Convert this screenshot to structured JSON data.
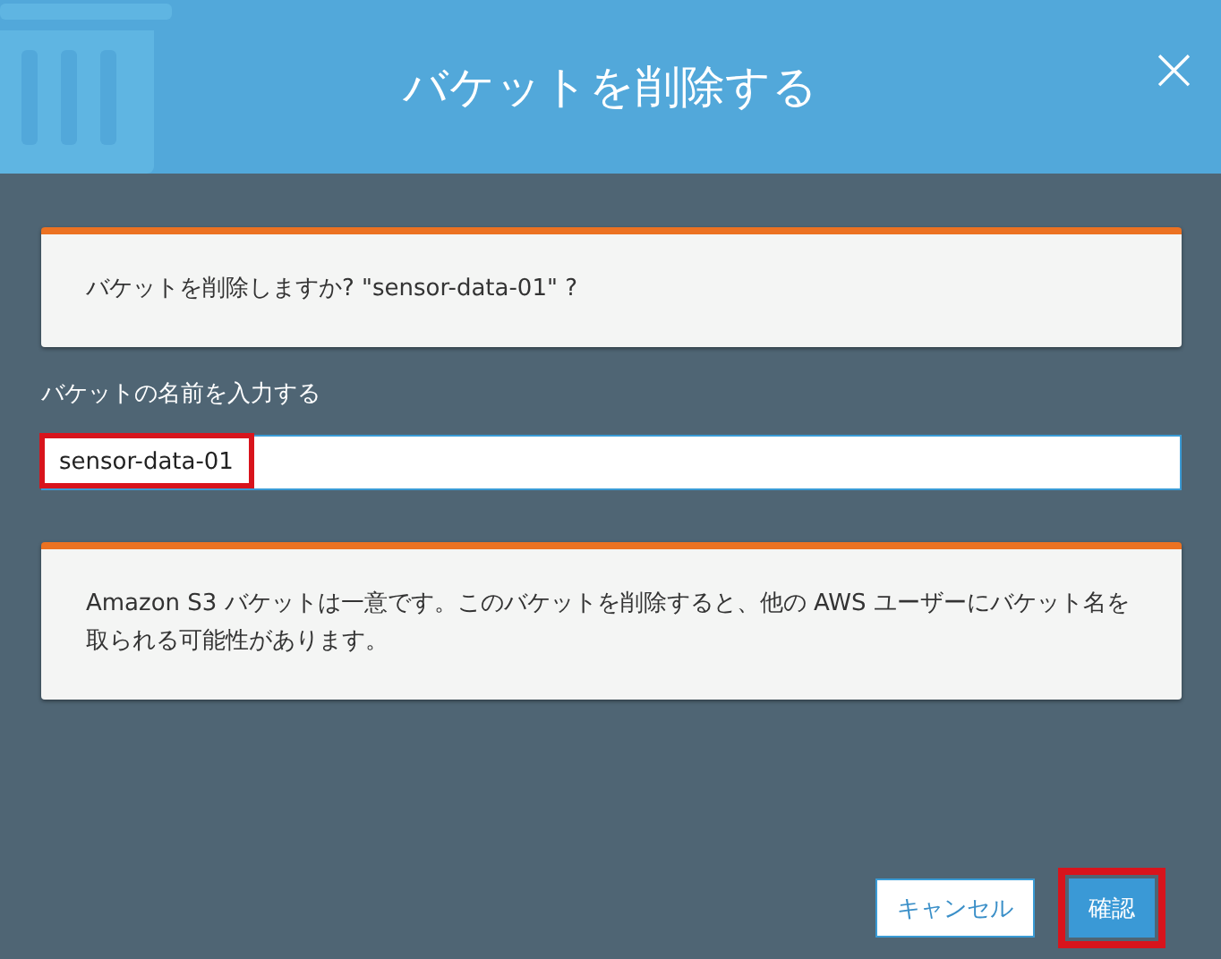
{
  "dialog": {
    "title": "バケットを削除する",
    "close": "×"
  },
  "confirm_message": "バケットを削除しますか? \"sensor-data-01\" ?",
  "name_field": {
    "label": "バケットの名前を入力する",
    "value": "sensor-data-01",
    "highlighted": true
  },
  "warning": "Amazon S3 バケットは一意です。このバケットを削除すると、他の AWS ユーザーにバケット名を取られる可能性があります。",
  "buttons": [
    {
      "kind": "secondary",
      "label": "キャンセル",
      "highlighted": false
    },
    {
      "kind": "primary",
      "label": "確認",
      "highlighted": true
    }
  ]
}
